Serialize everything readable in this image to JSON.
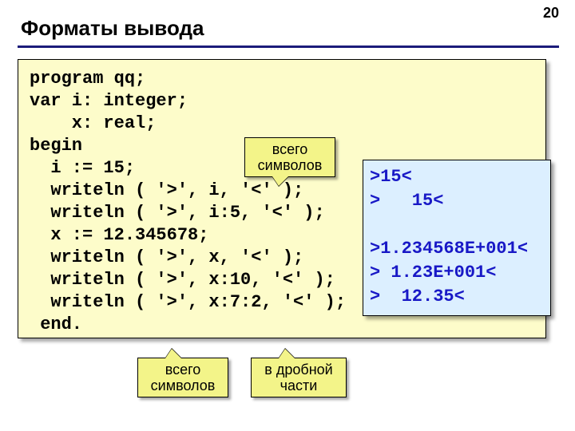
{
  "page_number": "20",
  "title": "Форматы вывода",
  "code": {
    "l1": "program qq;",
    "l2": "var i: integer;",
    "l3": "    x: real;",
    "l4": "begin",
    "l5": "  i := 15;",
    "l6": "  writeln ( '>', i, '<' );",
    "l7": "  writeln ( '>', i:5, '<' );",
    "l8": "  x := 12.345678;",
    "l9": "  writeln ( '>', x, '<' );",
    "l10": "  writeln ( '>', x:10, '<' );",
    "l11": "  writeln ( '>', x:7:2, '<' );",
    "l12": " end."
  },
  "output": {
    "o1": ">15<",
    "o2": ">   15<",
    "o3": "",
    "o4": ">1.234568E+001<",
    "o5": "> 1.23E+001<",
    "o6": ">  12.35<"
  },
  "callouts": {
    "total_chars1": "всего\nсимволов",
    "total_chars2": "всего\nсимволов",
    "fractional": "в дробной\nчасти"
  }
}
